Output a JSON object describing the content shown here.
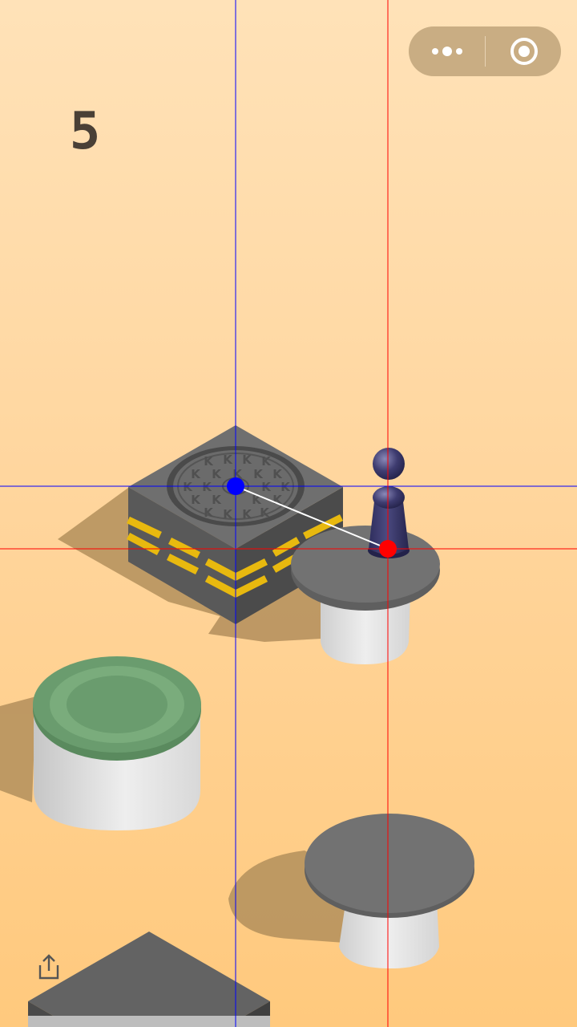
{
  "game": {
    "score": "5"
  },
  "colors": {
    "background_top": "#ffe2b8",
    "background_bottom": "#ffc97d",
    "score_text": "#4a4036",
    "player": "#3b3a6e",
    "guide_start": "#0000ff",
    "guide_end": "#ff0000",
    "platform_green": "#6a9c6e",
    "platform_gray": "#6e6e6e",
    "stripe_yellow": "#e8b90f"
  },
  "icons": {
    "more": "more-dots-icon",
    "close": "target-circle-icon",
    "share": "share-icon"
  }
}
